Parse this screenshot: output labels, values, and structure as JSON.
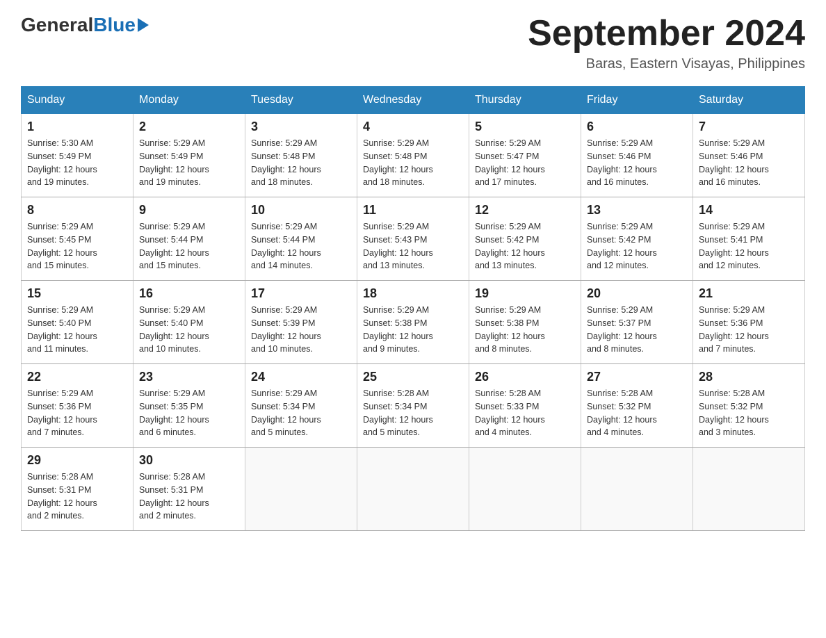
{
  "header": {
    "logo_general": "General",
    "logo_blue": "Blue",
    "month_title": "September 2024",
    "location": "Baras, Eastern Visayas, Philippines"
  },
  "days_of_week": [
    "Sunday",
    "Monday",
    "Tuesday",
    "Wednesday",
    "Thursday",
    "Friday",
    "Saturday"
  ],
  "weeks": [
    [
      {
        "day": "1",
        "sunrise": "5:30 AM",
        "sunset": "5:49 PM",
        "daylight": "12 hours and 19 minutes."
      },
      {
        "day": "2",
        "sunrise": "5:29 AM",
        "sunset": "5:49 PM",
        "daylight": "12 hours and 19 minutes."
      },
      {
        "day": "3",
        "sunrise": "5:29 AM",
        "sunset": "5:48 PM",
        "daylight": "12 hours and 18 minutes."
      },
      {
        "day": "4",
        "sunrise": "5:29 AM",
        "sunset": "5:48 PM",
        "daylight": "12 hours and 18 minutes."
      },
      {
        "day": "5",
        "sunrise": "5:29 AM",
        "sunset": "5:47 PM",
        "daylight": "12 hours and 17 minutes."
      },
      {
        "day": "6",
        "sunrise": "5:29 AM",
        "sunset": "5:46 PM",
        "daylight": "12 hours and 16 minutes."
      },
      {
        "day": "7",
        "sunrise": "5:29 AM",
        "sunset": "5:46 PM",
        "daylight": "12 hours and 16 minutes."
      }
    ],
    [
      {
        "day": "8",
        "sunrise": "5:29 AM",
        "sunset": "5:45 PM",
        "daylight": "12 hours and 15 minutes."
      },
      {
        "day": "9",
        "sunrise": "5:29 AM",
        "sunset": "5:44 PM",
        "daylight": "12 hours and 15 minutes."
      },
      {
        "day": "10",
        "sunrise": "5:29 AM",
        "sunset": "5:44 PM",
        "daylight": "12 hours and 14 minutes."
      },
      {
        "day": "11",
        "sunrise": "5:29 AM",
        "sunset": "5:43 PM",
        "daylight": "12 hours and 13 minutes."
      },
      {
        "day": "12",
        "sunrise": "5:29 AM",
        "sunset": "5:42 PM",
        "daylight": "12 hours and 13 minutes."
      },
      {
        "day": "13",
        "sunrise": "5:29 AM",
        "sunset": "5:42 PM",
        "daylight": "12 hours and 12 minutes."
      },
      {
        "day": "14",
        "sunrise": "5:29 AM",
        "sunset": "5:41 PM",
        "daylight": "12 hours and 12 minutes."
      }
    ],
    [
      {
        "day": "15",
        "sunrise": "5:29 AM",
        "sunset": "5:40 PM",
        "daylight": "12 hours and 11 minutes."
      },
      {
        "day": "16",
        "sunrise": "5:29 AM",
        "sunset": "5:40 PM",
        "daylight": "12 hours and 10 minutes."
      },
      {
        "day": "17",
        "sunrise": "5:29 AM",
        "sunset": "5:39 PM",
        "daylight": "12 hours and 10 minutes."
      },
      {
        "day": "18",
        "sunrise": "5:29 AM",
        "sunset": "5:38 PM",
        "daylight": "12 hours and 9 minutes."
      },
      {
        "day": "19",
        "sunrise": "5:29 AM",
        "sunset": "5:38 PM",
        "daylight": "12 hours and 8 minutes."
      },
      {
        "day": "20",
        "sunrise": "5:29 AM",
        "sunset": "5:37 PM",
        "daylight": "12 hours and 8 minutes."
      },
      {
        "day": "21",
        "sunrise": "5:29 AM",
        "sunset": "5:36 PM",
        "daylight": "12 hours and 7 minutes."
      }
    ],
    [
      {
        "day": "22",
        "sunrise": "5:29 AM",
        "sunset": "5:36 PM",
        "daylight": "12 hours and 7 minutes."
      },
      {
        "day": "23",
        "sunrise": "5:29 AM",
        "sunset": "5:35 PM",
        "daylight": "12 hours and 6 minutes."
      },
      {
        "day": "24",
        "sunrise": "5:29 AM",
        "sunset": "5:34 PM",
        "daylight": "12 hours and 5 minutes."
      },
      {
        "day": "25",
        "sunrise": "5:28 AM",
        "sunset": "5:34 PM",
        "daylight": "12 hours and 5 minutes."
      },
      {
        "day": "26",
        "sunrise": "5:28 AM",
        "sunset": "5:33 PM",
        "daylight": "12 hours and 4 minutes."
      },
      {
        "day": "27",
        "sunrise": "5:28 AM",
        "sunset": "5:32 PM",
        "daylight": "12 hours and 4 minutes."
      },
      {
        "day": "28",
        "sunrise": "5:28 AM",
        "sunset": "5:32 PM",
        "daylight": "12 hours and 3 minutes."
      }
    ],
    [
      {
        "day": "29",
        "sunrise": "5:28 AM",
        "sunset": "5:31 PM",
        "daylight": "12 hours and 2 minutes."
      },
      {
        "day": "30",
        "sunrise": "5:28 AM",
        "sunset": "5:31 PM",
        "daylight": "12 hours and 2 minutes."
      },
      null,
      null,
      null,
      null,
      null
    ]
  ],
  "labels": {
    "sunrise": "Sunrise:",
    "sunset": "Sunset:",
    "daylight": "Daylight:"
  }
}
